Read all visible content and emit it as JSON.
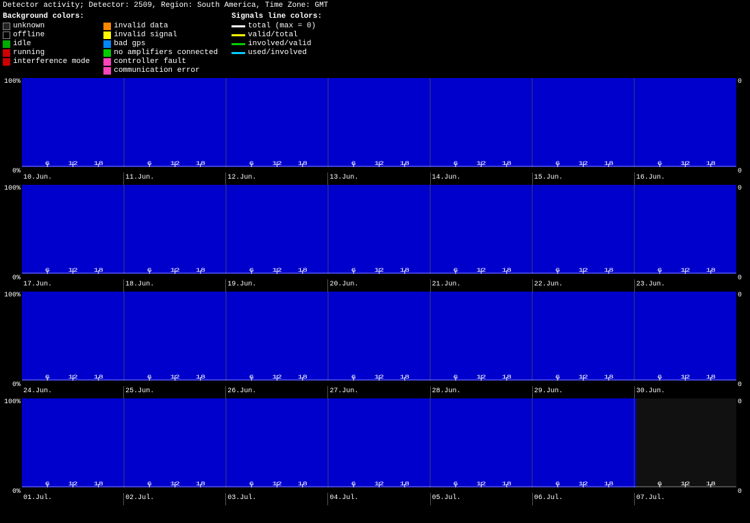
{
  "header": {
    "title": "Detector activity; Detector: 2509, Region: South America, Time Zone: GMT"
  },
  "legend": {
    "bg_title": "Background colors:",
    "sig_title": "Signals line colors:",
    "bg_items": [
      {
        "label": "unknown",
        "color": "#222",
        "border": "#888"
      },
      {
        "label": "offline",
        "color": "#000",
        "border": "#888"
      },
      {
        "label": "idle",
        "color": "#00aa00",
        "border": "#00aa00"
      },
      {
        "label": "running",
        "color": "#cc0000",
        "border": "#cc0000"
      },
      {
        "label": "interference mode",
        "color": "#cc0000",
        "border": "#cc0000"
      }
    ],
    "invalid_items": [
      {
        "label": "invalid data",
        "color": "#ff8800"
      },
      {
        "label": "invalid signal",
        "color": "#ffff00"
      },
      {
        "label": "bad gps",
        "color": "#0088ff"
      },
      {
        "label": "no amplifiers connected",
        "color": "#00cc00"
      },
      {
        "label": "controller fault",
        "color": "#ff44aa"
      },
      {
        "label": "communication error",
        "color": "#ff44aa"
      }
    ],
    "sig_items": [
      {
        "label": "total (max = 0)",
        "color": "#fff"
      },
      {
        "label": "valid/total",
        "color": "#ffff00"
      },
      {
        "label": "involved/valid",
        "color": "#00cc00"
      },
      {
        "label": "used/involved",
        "color": "#00ccff"
      }
    ]
  },
  "chart_rows": [
    {
      "id": "row1",
      "days": [
        "10.Jun.",
        "11.Jun.",
        "12.Jun.",
        "13.Jun.",
        "14.Jun.",
        "15.Jun.",
        "16.Jun."
      ],
      "blue_full": true,
      "partial_end": false
    },
    {
      "id": "row2",
      "days": [
        "17.Jun.",
        "18.Jun.",
        "19.Jun.",
        "20.Jun.",
        "21.Jun.",
        "22.Jun.",
        "23.Jun."
      ],
      "blue_full": true,
      "partial_end": false
    },
    {
      "id": "row3",
      "days": [
        "24.Jun.",
        "25.Jun.",
        "26.Jun.",
        "27.Jun.",
        "28.Jun.",
        "29.Jun.",
        "30.Jun."
      ],
      "blue_full": true,
      "partial_end": false
    },
    {
      "id": "row4",
      "days": [
        "01.Jul.",
        "02.Jul.",
        "03.Jul.",
        "04.Jul.",
        "05.Jul.",
        "06.Jul.",
        "07.Jul."
      ],
      "blue_full": false,
      "partial_end": true,
      "partial_at": 6
    }
  ],
  "y_labels": [
    "100%",
    "0%"
  ],
  "y_right_labels": [
    "0",
    "0"
  ],
  "tick_hours": [
    6,
    12,
    18
  ]
}
